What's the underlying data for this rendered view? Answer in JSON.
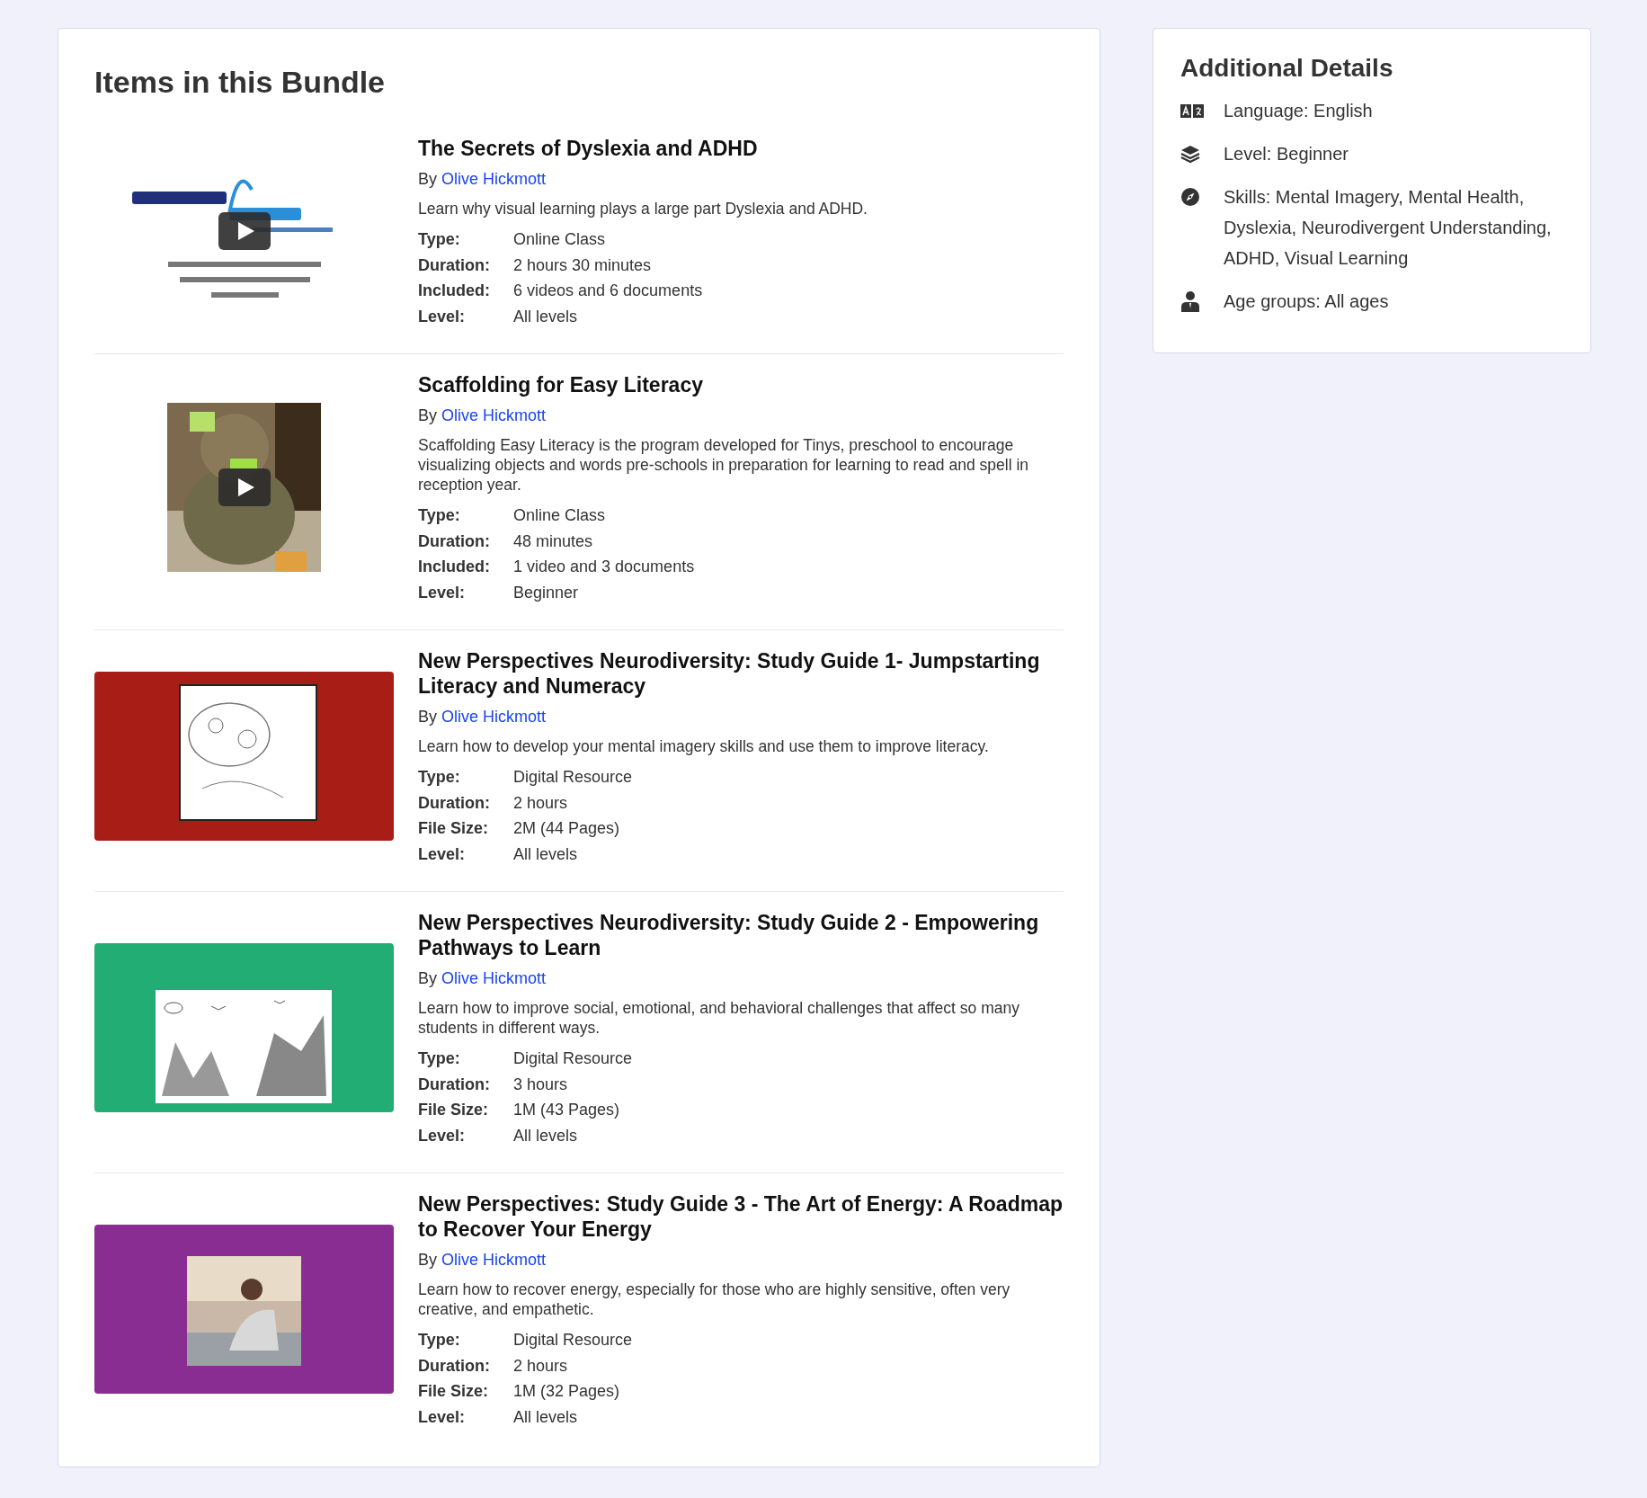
{
  "bundle": {
    "title": "Items in this Bundle",
    "items": [
      {
        "title": "The Secrets of Dyslexia and ADHD",
        "by": "By",
        "author": "Olive Hickmott",
        "description": "Learn why visual learning plays a large part Dyslexia and ADHD.",
        "video": true,
        "details": [
          {
            "label": "Type:",
            "value": "Online Class"
          },
          {
            "label": "Duration:",
            "value": "2 hours 30 minutes"
          },
          {
            "label": "Included:",
            "value": "6 videos and 6 documents"
          },
          {
            "label": "Level:",
            "value": "All levels"
          }
        ]
      },
      {
        "title": "Scaffolding for Easy Literacy",
        "by": "By",
        "author": "Olive Hickmott",
        "description": "Scaffolding Easy Literacy is the program developed for Tinys, preschool to encourage visualizing objects and words pre-schools in preparation for learning to read and spell in reception year.",
        "video": true,
        "details": [
          {
            "label": "Type:",
            "value": "Online Class"
          },
          {
            "label": "Duration:",
            "value": "48 minutes"
          },
          {
            "label": "Included:",
            "value": "1 video and 3 documents"
          },
          {
            "label": "Level:",
            "value": "Beginner"
          }
        ]
      },
      {
        "title": "New Perspectives Neurodiversity: Study Guide 1- Jumpstarting Literacy and Numeracy",
        "by": "By",
        "author": "Olive Hickmott",
        "description": "Learn how to develop your mental imagery skills and use them to improve literacy.",
        "video": false,
        "details": [
          {
            "label": "Type:",
            "value": "Digital Resource"
          },
          {
            "label": "Duration:",
            "value": "2 hours"
          },
          {
            "label": "File Size:",
            "value": "2M (44 Pages)"
          },
          {
            "label": "Level:",
            "value": "All levels"
          }
        ]
      },
      {
        "title": "New Perspectives Neurodiversity: Study Guide 2 - Empowering Pathways to Learn",
        "by": "By",
        "author": "Olive Hickmott",
        "description": "Learn how to improve social, emotional, and behavioral challenges that affect so many students in different ways.",
        "video": false,
        "details": [
          {
            "label": "Type:",
            "value": "Digital Resource"
          },
          {
            "label": "Duration:",
            "value": "3 hours"
          },
          {
            "label": "File Size:",
            "value": "1M (43 Pages)"
          },
          {
            "label": "Level:",
            "value": "All levels"
          }
        ]
      },
      {
        "title": "New Perspectives: Study Guide 3 - The Art of Energy: A Roadmap to Recover Your Energy",
        "by": "By",
        "author": "Olive Hickmott",
        "description": "Learn how to recover energy, especially for those who are highly sensitive, often very creative, and empathetic.",
        "video": false,
        "details": [
          {
            "label": "Type:",
            "value": "Digital Resource"
          },
          {
            "label": "Duration:",
            "value": "2 hours"
          },
          {
            "label": "File Size:",
            "value": "1M (32 Pages)"
          },
          {
            "label": "Level:",
            "value": "All levels"
          }
        ]
      }
    ]
  },
  "additional_details": {
    "title": "Additional Details",
    "items": [
      {
        "kind": "language",
        "text": "Language: English"
      },
      {
        "kind": "level",
        "text": "Level: Beginner"
      },
      {
        "kind": "skills",
        "text": "Skills: Mental Imagery, Mental Health, Dyslexia, Neurodivergent Understanding, ADHD, Visual Learning"
      },
      {
        "kind": "age",
        "text": "Age groups: All ages"
      }
    ]
  }
}
